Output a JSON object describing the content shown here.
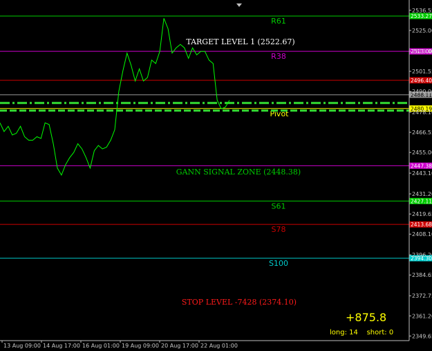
{
  "colors": {
    "background": "#000000",
    "price_line": "#00ff00",
    "pivot_dash": "#33dd33",
    "axis_text": "#c8c8c8",
    "axis_line": "#bfbfbf"
  },
  "chart_data": {
    "type": "line",
    "y_axis_position": "right",
    "ylim": [
      2347,
      2538.5
    ],
    "grid": false,
    "y_ticks": [
      2536.55,
      2525.0,
      2513.0,
      2501.55,
      2490.0,
      2478.1,
      2466.55,
      2455.0,
      2443.1,
      2431.2,
      2419.65,
      2408.1,
      2396.2,
      2384.65,
      2372.75,
      2361.2,
      2349.65
    ],
    "x_tick_labels": [
      "13 Aug 09:00",
      "14 Aug 17:00",
      "16 Aug 01:00",
      "19 Aug 09:00",
      "20 Aug 17:00",
      "22 Aug 01:00"
    ],
    "series": [
      {
        "values": [
          2472,
          2467,
          2470,
          2465,
          2466,
          2470,
          2464,
          2462,
          2462,
          2464,
          2463,
          2472,
          2471,
          2460,
          2446,
          2442,
          2448,
          2452,
          2455,
          2460,
          2457,
          2452,
          2446,
          2456,
          2459,
          2457,
          2458,
          2462,
          2468,
          2490,
          2502,
          2512,
          2505,
          2496,
          2503,
          2496,
          2498,
          2508,
          2506,
          2513,
          2532,
          2526,
          2512,
          2515,
          2517,
          2515,
          2509,
          2515,
          2511,
          2513,
          2513,
          2508,
          2506,
          2485,
          2480,
          2481,
          2485
        ]
      }
    ],
    "levels": [
      {
        "name": "R61",
        "value": 2533.27,
        "tag": "2533.27",
        "color": "#00cc00"
      },
      {
        "name": "R38",
        "value": 2513.0,
        "tag": "2513.00",
        "color": "#cc00cc"
      },
      {
        "name": "",
        "value": 2496.4,
        "tag": "2496.40",
        "color": "#cc0000"
      },
      {
        "name": "",
        "value": 2488.11,
        "tag": "2488.11",
        "color": "#9a9a9a"
      },
      {
        "name": "Pivot",
        "value": 2480.19,
        "tag": "2480.19",
        "color": "#ffff00"
      },
      {
        "name": "",
        "value": 2447.38,
        "tag": "2447.38",
        "color": "#cc00cc"
      },
      {
        "name": "S61",
        "value": 2427.11,
        "tag": "2427.11",
        "color": "#00cc00"
      },
      {
        "name": "S78",
        "value": 2413.68,
        "tag": "2413.68",
        "color": "#cc0000"
      },
      {
        "name": "S100",
        "value": 2394.3,
        "tag": "2394.30",
        "color": "#00cccc"
      }
    ],
    "annotations": [
      {
        "text": "TARGET LEVEL 1 (2522.67)",
        "color": "#ffffff"
      },
      {
        "text": "GANN SIGNAL ZONE (2448.38)",
        "color": "#00cc00"
      },
      {
        "text": "STOP LEVEL -7428 (2374.10)",
        "color": "#ff1a1a"
      }
    ]
  },
  "stats": {
    "profit": "+875.8",
    "trades": "long: 14    short: 0"
  }
}
